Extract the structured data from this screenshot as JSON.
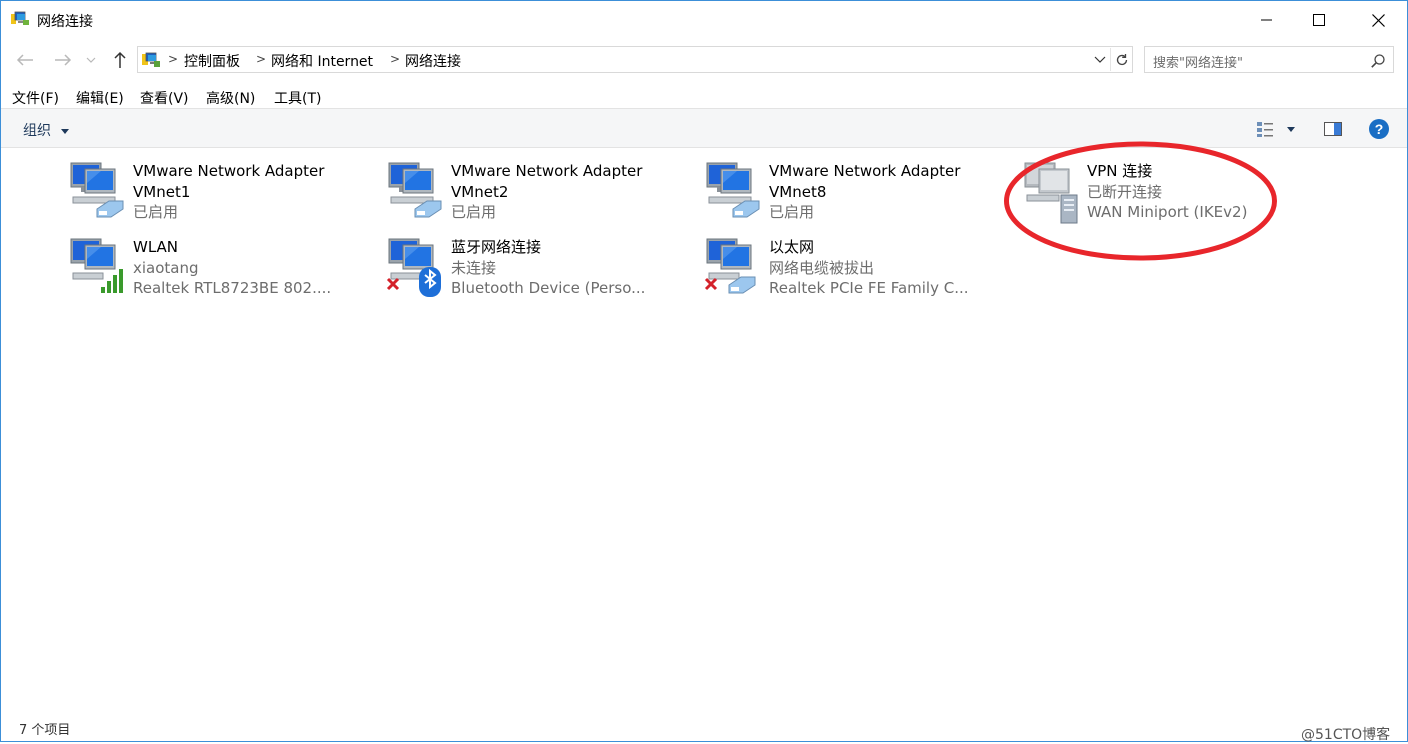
{
  "window": {
    "title": "网络连接"
  },
  "address": {
    "breadcrumb": [
      "控制面板",
      "网络和 Internet",
      "网络连接"
    ],
    "search_placeholder": "搜索\"网络连接\""
  },
  "menu": {
    "items": [
      "文件(F)",
      "编辑(E)",
      "查看(V)",
      "高级(N)",
      "工具(T)"
    ]
  },
  "toolbar": {
    "organize_label": "组织"
  },
  "connections": [
    {
      "name": "VMware Network Adapter",
      "name2": "VMnet1",
      "status": "已启用",
      "device": ""
    },
    {
      "name": "VMware Network Adapter",
      "name2": "VMnet2",
      "status": "已启用",
      "device": ""
    },
    {
      "name": "VMware Network Adapter",
      "name2": "VMnet8",
      "status": "已启用",
      "device": ""
    },
    {
      "name": "VPN 连接",
      "name2": "",
      "status": "已断开连接",
      "device": "WAN Miniport (IKEv2)"
    },
    {
      "name": "WLAN",
      "name2": "",
      "status": "xiaotang",
      "device": "Realtek RTL8723BE 802...."
    },
    {
      "name": "蓝牙网络连接",
      "name2": "",
      "status": "未连接",
      "device": "Bluetooth Device (Perso..."
    },
    {
      "name": "以太网",
      "name2": "",
      "status": "网络电缆被拔出",
      "device": "Realtek PCIe FE Family C..."
    }
  ],
  "statusbar": {
    "item_count": "7 个项目",
    "watermark": "@51CTO博客"
  },
  "colors": {
    "highlight": "#e8262b",
    "help": "#1a6ec4",
    "accent": "#3c8fd8"
  }
}
